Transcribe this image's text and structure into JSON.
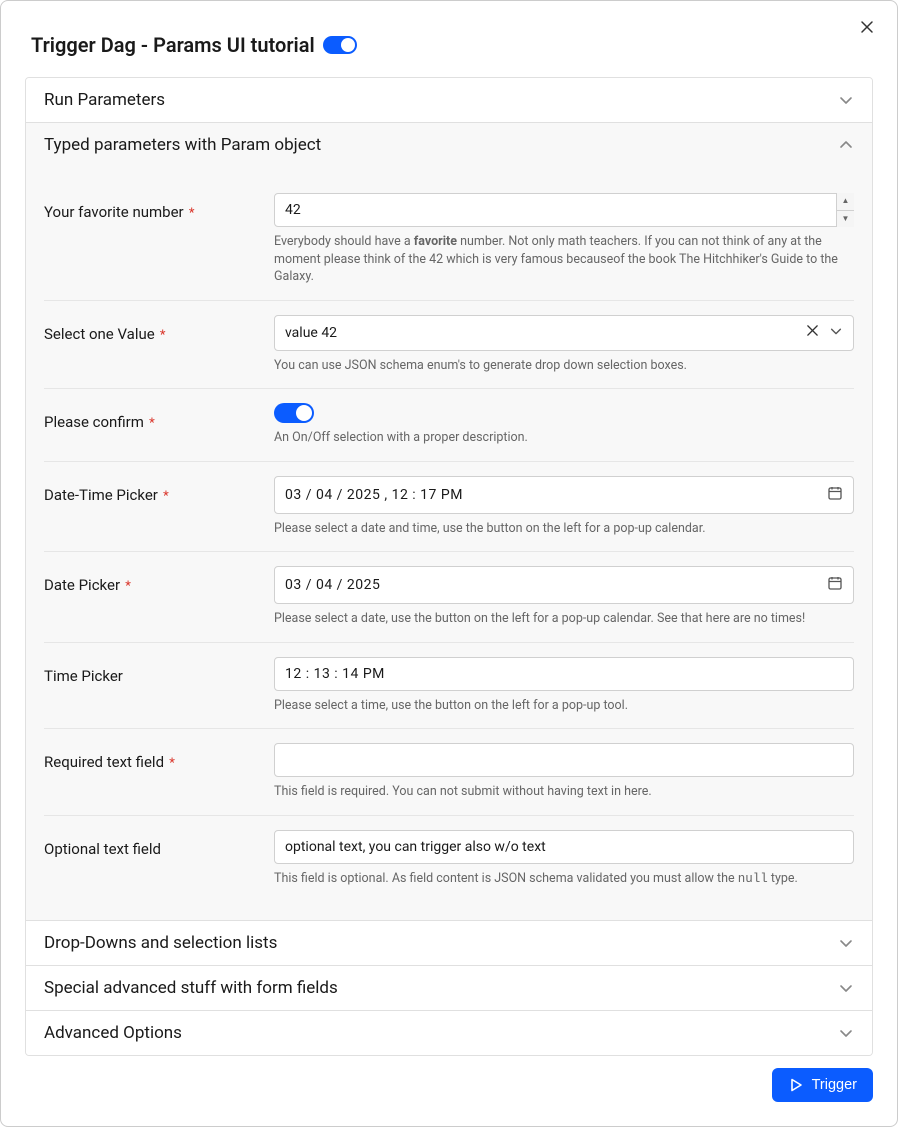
{
  "modal": {
    "title": "Trigger Dag - Params UI tutorial",
    "header_toggle_on": true,
    "close_label": "Close"
  },
  "sections": {
    "run_parameters": {
      "title": "Run Parameters",
      "expanded": false
    },
    "typed": {
      "title": "Typed parameters with Param object",
      "expanded": true
    },
    "dropdowns": {
      "title": "Drop-Downs and selection lists",
      "expanded": false
    },
    "special": {
      "title": "Special advanced stuff with form fields",
      "expanded": false
    },
    "advanced": {
      "title": "Advanced Options",
      "expanded": false
    }
  },
  "fields": {
    "fav_number": {
      "label": "Your favorite number",
      "required": true,
      "value": "42",
      "helper_prefix": "Everybody should have a ",
      "helper_bold": "favorite",
      "helper_suffix": " number. Not only math teachers. If you can not think of any at the moment please think of the 42 which is very famous becauseof the book The Hitchhiker's Guide to the Galaxy."
    },
    "select_one": {
      "label": "Select one Value",
      "required": true,
      "value": "value 42",
      "helper": "You can use JSON schema enum's to generate drop down selection boxes."
    },
    "confirm": {
      "label": "Please confirm",
      "required": true,
      "value_on": true,
      "helper": "An On/Off selection with a proper description."
    },
    "datetime": {
      "label": "Date-Time Picker",
      "required": true,
      "value": "03 / 04 / 2025 ,  12 : 17   PM",
      "helper": "Please select a date and time, use the button on the left for a pop-up calendar."
    },
    "date": {
      "label": "Date Picker",
      "required": true,
      "value": "03 / 04 / 2025",
      "helper": "Please select a date, use the button on the left for a pop-up calendar. See that here are no times!"
    },
    "time": {
      "label": "Time Picker",
      "required": false,
      "value": "12 : 13 : 14   PM",
      "helper": "Please select a time, use the button on the left for a pop-up tool."
    },
    "required_text": {
      "label": "Required text field",
      "required": true,
      "value": "",
      "helper": "This field is required. You can not submit without having text in here."
    },
    "optional_text": {
      "label": "Optional text field",
      "required": false,
      "value": "optional text, you can trigger also w/o text",
      "helper_prefix": "This field is optional. As field content is JSON schema validated you must allow the ",
      "helper_code": "null",
      "helper_suffix": " type."
    }
  },
  "footer": {
    "trigger_label": "Trigger"
  }
}
